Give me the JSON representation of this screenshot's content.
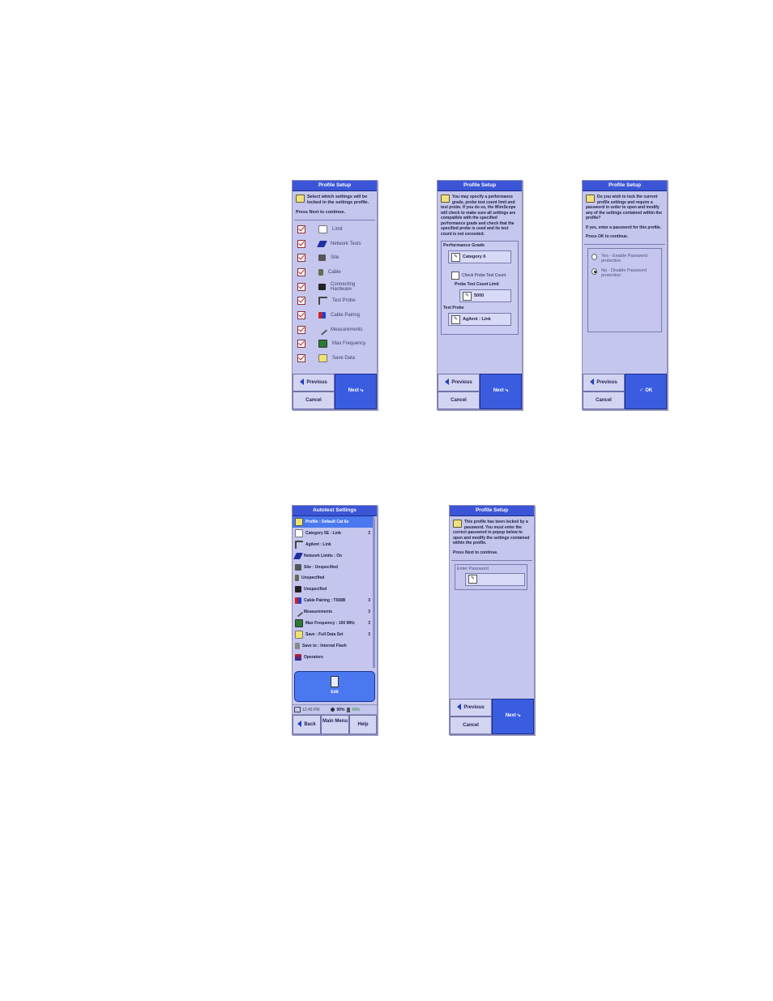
{
  "screens": {
    "select": {
      "title": "Profile Setup",
      "intro1": "Select which settings will be locked in the settings profile.",
      "intro2": "Press Next to continue.",
      "items": [
        "Limit",
        "Network Tests",
        "Site",
        "Cable",
        "Connecting Hardware",
        "Test Probe",
        "Cable Pairing",
        "Measurements",
        "Max Frequency",
        "Save Data"
      ],
      "previous": "Previous",
      "next": "Next",
      "cancel": "Cancel"
    },
    "grade": {
      "title": "Profile Setup",
      "intro": "You may specify a performance grade, probe test count limit and test probe. If you do so, the WireScope will check to make sure all settings are compatible with the specified performance grade and check that the specified probe is used and its test count is not exceeded.",
      "perf_label": "Performance Grade",
      "perf_value": "Category 6",
      "check_label": "Check Probe Test Count",
      "count_label": "Probe Test Count Limit",
      "count_value": "5000",
      "probe_label": "Test Probe",
      "probe_value": "Agilent : Link",
      "previous": "Previous",
      "next": "Next",
      "cancel": "Cancel"
    },
    "lock": {
      "title": "Profile Setup",
      "intro1": "Do you wish to lock the current profile settings and require a password in order to open and modify any of the settings contained within the profile?",
      "intro2": "If yes, enter a password for this profile.",
      "intro3": "Press OK to continue.",
      "yes_option": "Yes - Enable Password protection",
      "no_option": "No - Disable Password protection",
      "previous": "Previous",
      "ok": "OK",
      "cancel": "Cancel"
    },
    "autotest": {
      "title": "Autotest Settings",
      "items": [
        {
          "label": "Profile : Default Cat 6e",
          "tail": ""
        },
        {
          "label": "Category 5E : Link",
          "tail": "3"
        },
        {
          "label": "Agilent : Link",
          "tail": ""
        },
        {
          "label": "Network Limits : On",
          "tail": ""
        },
        {
          "label": "Site : Unspecified",
          "tail": ""
        },
        {
          "label": "Unspecified",
          "tail": ""
        },
        {
          "label": "Unspecified",
          "tail": ""
        },
        {
          "label": "Cable Pairing : T568B",
          "tail": "3"
        },
        {
          "label": "Measurements",
          "tail": "3"
        },
        {
          "label": "Max Frequency : 100 MHz",
          "tail": "3"
        },
        {
          "label": "Save : Full Data Set",
          "tail": "3"
        },
        {
          "label": "Save to : Internal Flash",
          "tail": ""
        },
        {
          "label": "Operators",
          "tail": ""
        }
      ],
      "edit": "Edit",
      "time": "12:45 PM",
      "battery1": "99%",
      "battery2": "99%",
      "back": "Back",
      "main_menu": "Main Menu",
      "help": "Help"
    },
    "password": {
      "title": "Profile Setup",
      "intro1": "This profile has been locked by a password. You must enter the correct password in popup below to open and modify the settings contained within the profile.",
      "intro2": "Press Next to continue.",
      "field_label": "Enter Password",
      "previous": "Previous",
      "next": "Next",
      "cancel": "Cancel"
    }
  },
  "colors": {
    "screen_bg": "#c4c6ee",
    "titlebar": "#3b55d6",
    "button_blue": "#3a5de0",
    "selection": "#4a78f0"
  }
}
